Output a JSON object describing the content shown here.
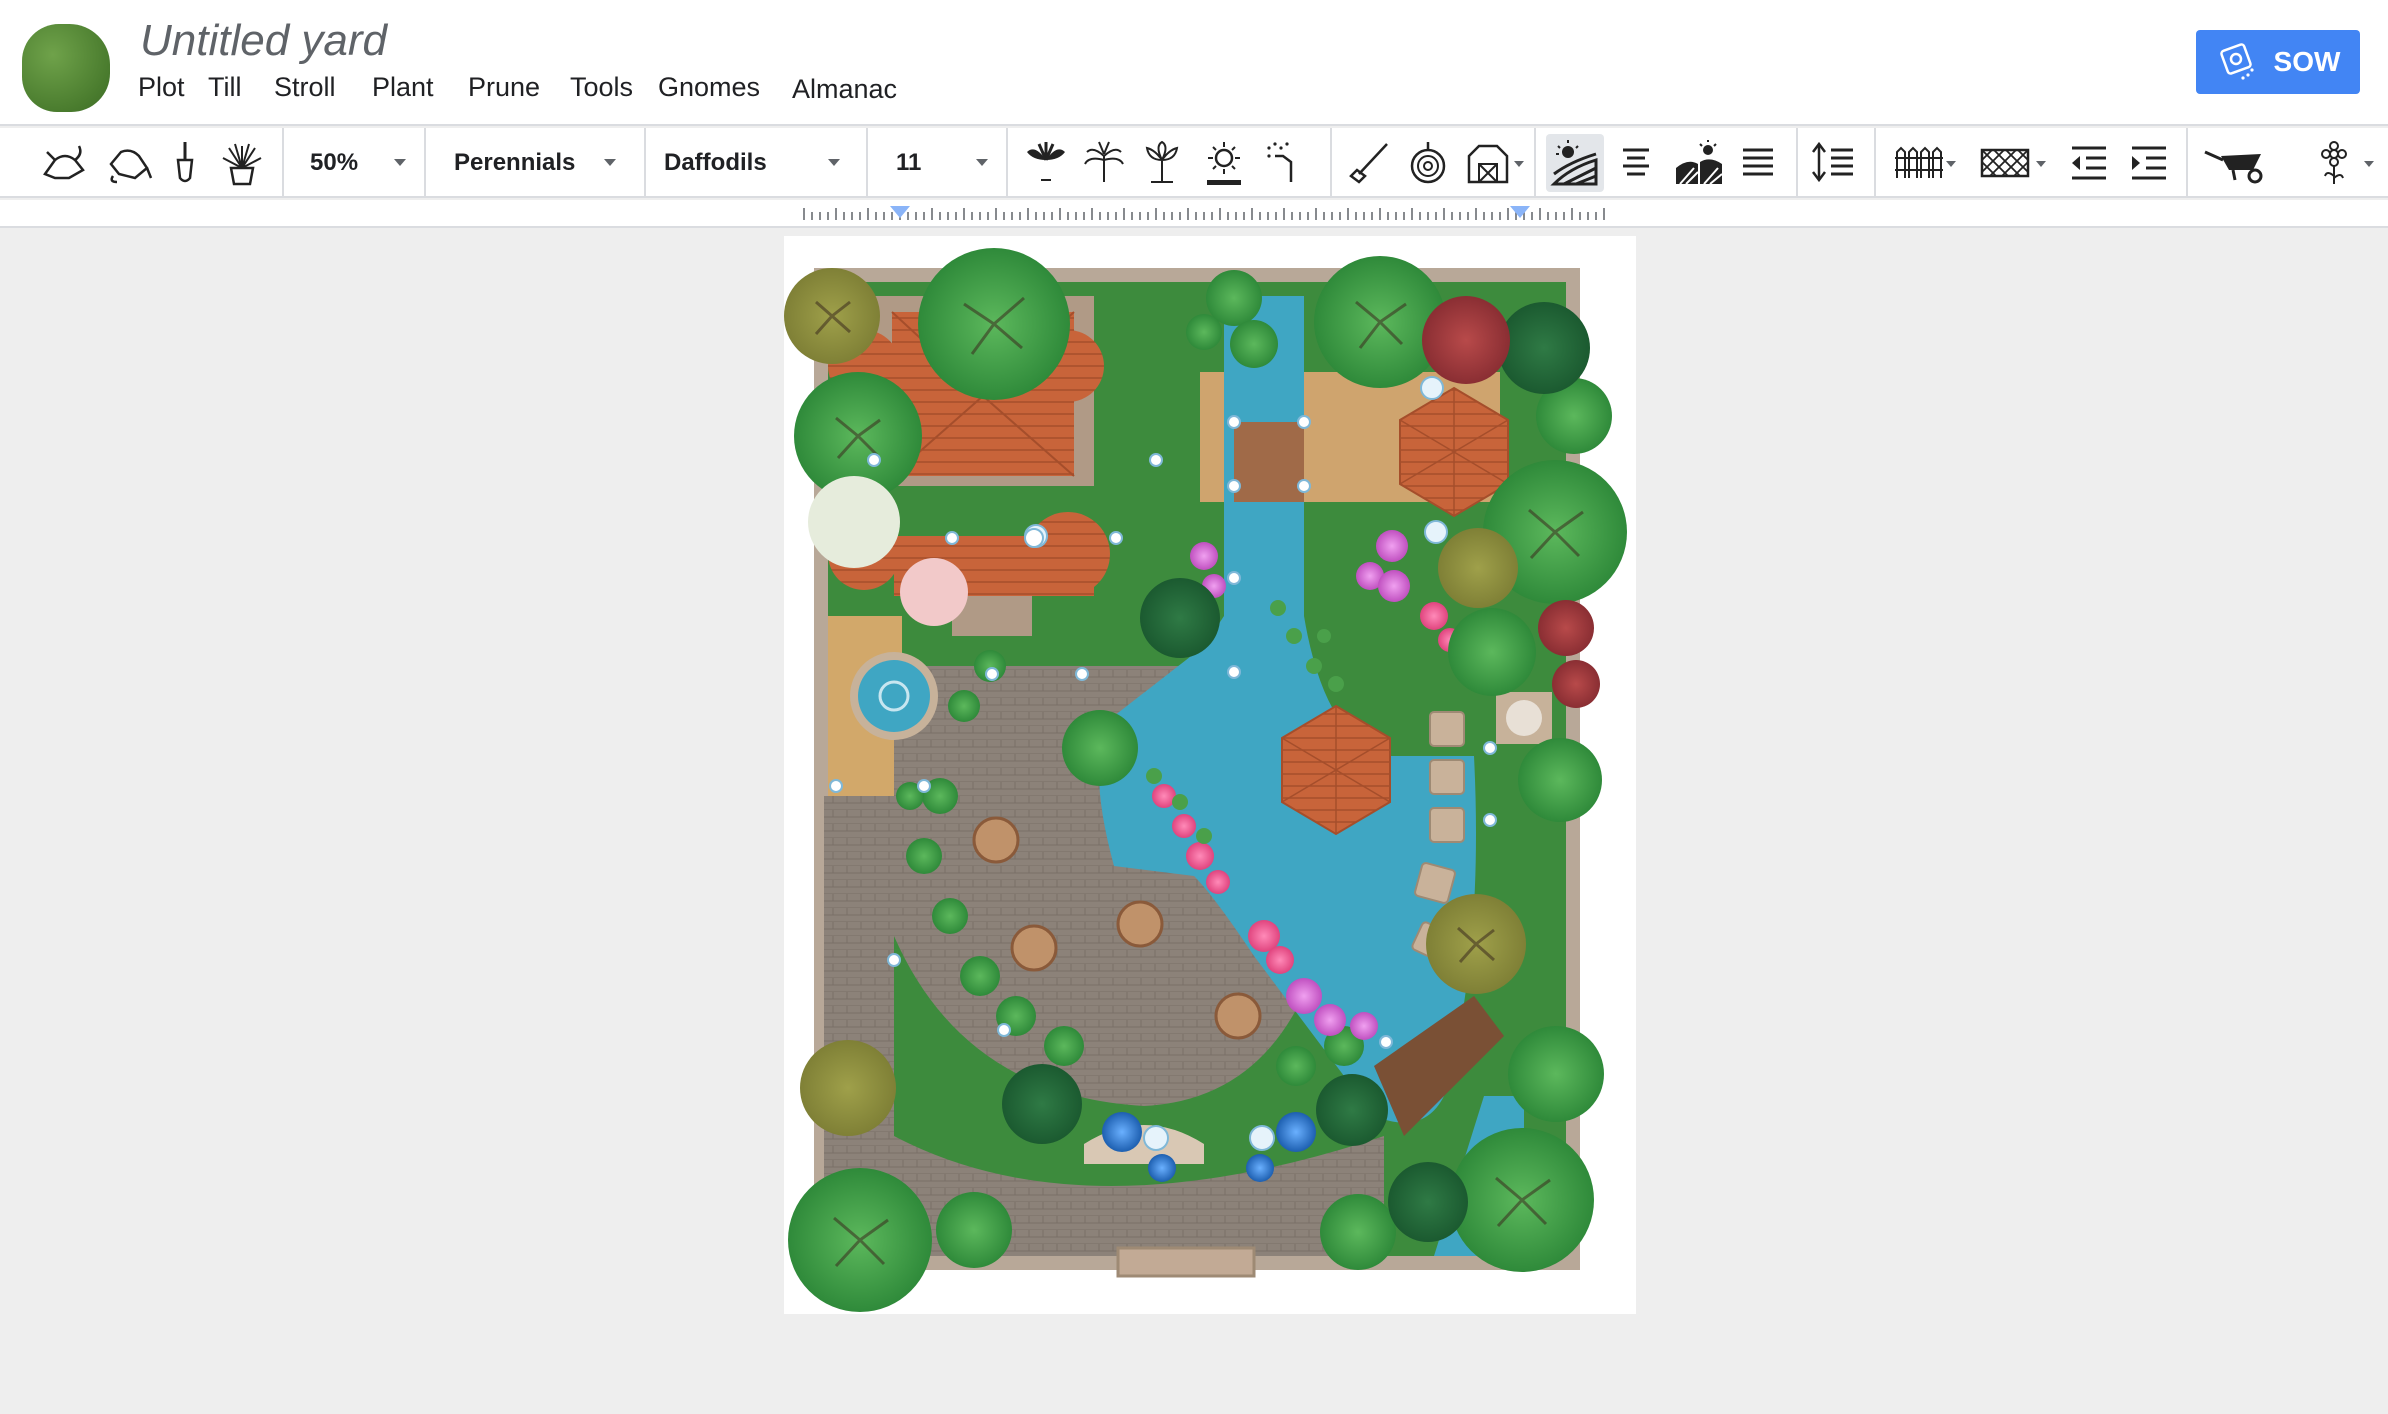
{
  "header": {
    "doc_title": "Untitled yard",
    "menu": [
      "Plot",
      "Till",
      "Stroll",
      "Plant",
      "Prune",
      "Tools",
      "Gnomes",
      "Almanac"
    ],
    "sow_label": "SOW"
  },
  "toolbar": {
    "zoom": "50%",
    "category": "Perennials",
    "variety": "Daffodils",
    "size": "11"
  },
  "icons": {
    "group1": [
      "watering-can-icon",
      "watering-can-tilt-icon",
      "trowel-icon",
      "potted-plant-icon"
    ],
    "group2": [
      "lotus-icon",
      "fern-icon",
      "tulip-icon",
      "sunflower-icon",
      "sprinkler-icon"
    ],
    "group3": [
      "rake-icon",
      "hose-reel-icon",
      "barn-icon"
    ],
    "group4": [
      "sunny-field-icon",
      "align-center-icon",
      "sunrise-field-icon",
      "justify-icon"
    ],
    "group5": [
      "line-spacing-icon"
    ],
    "group6": [
      "fence-icon",
      "trellis-icon",
      "decrease-indent-icon",
      "increase-indent-icon"
    ],
    "group7": [
      "wheelbarrow-icon",
      "flower-icon"
    ]
  },
  "colors": {
    "accent": "#4285f4",
    "water": "#3fa6c3",
    "roof": "#c8643a",
    "paving": "#8c8279",
    "lawn": "#3d8b3d"
  }
}
